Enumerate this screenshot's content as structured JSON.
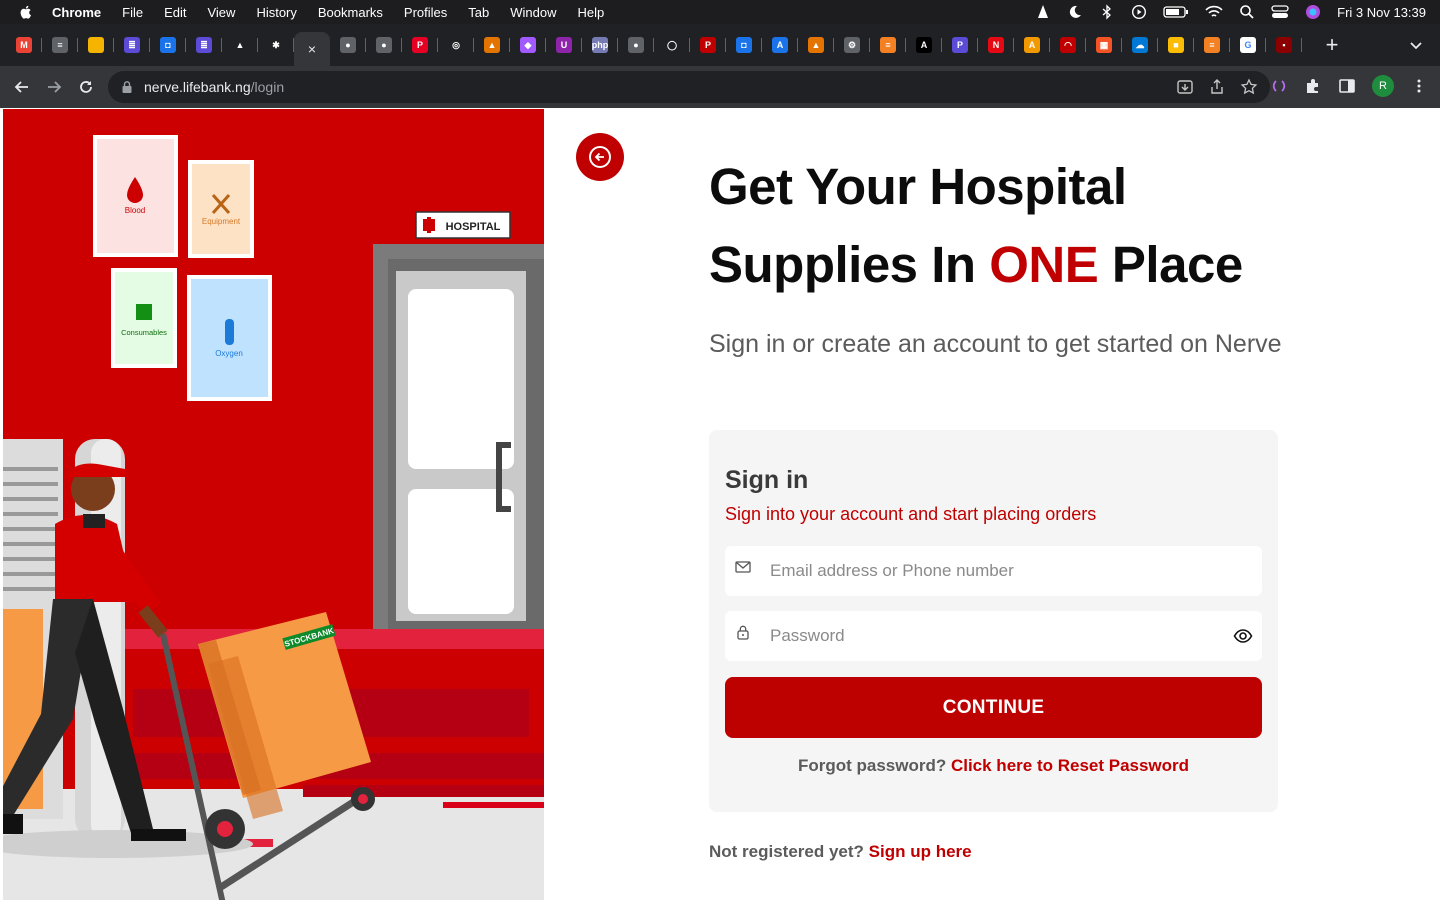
{
  "menubar": {
    "app": "Chrome",
    "items": [
      "File",
      "Edit",
      "View",
      "History",
      "Bookmarks",
      "Profiles",
      "Tab",
      "Window",
      "Help"
    ],
    "clock": "Fri 3 Nov  13:39"
  },
  "tabs": [
    {
      "icon": "gmail-icon",
      "color": "#ea4335",
      "glyph": "M"
    },
    {
      "icon": "docs-icon",
      "color": "#5f6368",
      "glyph": "≡"
    },
    {
      "icon": "slides-icon",
      "color": "#f4b400",
      "glyph": ""
    },
    {
      "icon": "list-icon",
      "color": "#5b4bd6",
      "glyph": "≣"
    },
    {
      "icon": "shield-tab-icon",
      "color": "#1a73e8",
      "glyph": "◘"
    },
    {
      "icon": "list-icon",
      "color": "#5b4bd6",
      "glyph": "≣"
    },
    {
      "icon": "mountain-icon",
      "color": "#202124",
      "glyph": "▲"
    },
    {
      "icon": "slack-icon",
      "color": "#202124",
      "glyph": "✱"
    },
    {
      "icon": "active-tab-close-icon",
      "color": "#35363a",
      "glyph": "×",
      "active": true
    },
    {
      "icon": "globe-icon",
      "color": "#5f6368",
      "glyph": "●"
    },
    {
      "icon": "globe-icon",
      "color": "#5f6368",
      "glyph": "●"
    },
    {
      "icon": "pinterest-icon",
      "color": "#e60023",
      "glyph": "P"
    },
    {
      "icon": "search-tab-icon",
      "color": "#202124",
      "glyph": "◎"
    },
    {
      "icon": "mountain-icon",
      "color": "#e37400",
      "glyph": "▲"
    },
    {
      "icon": "figma-icon",
      "color": "#a259ff",
      "glyph": "◆"
    },
    {
      "icon": "shield-purple-icon",
      "color": "#8e24aa",
      "glyph": "U"
    },
    {
      "icon": "php-icon",
      "color": "#777bb3",
      "glyph": "php"
    },
    {
      "icon": "globe-icon",
      "color": "#5f6368",
      "glyph": "●"
    },
    {
      "icon": "github-icon",
      "color": "#202124",
      "glyph": "◯"
    },
    {
      "icon": "pinterest-icon",
      "color": "#c00000",
      "glyph": "P"
    },
    {
      "icon": "shield-tab-icon",
      "color": "#1a73e8",
      "glyph": "◘"
    },
    {
      "icon": "app-a-icon",
      "color": "#1a73e8",
      "glyph": "A"
    },
    {
      "icon": "mountain-icon",
      "color": "#e37400",
      "glyph": "▲"
    },
    {
      "icon": "gear-tab-icon",
      "color": "#5f6368",
      "glyph": "⚙"
    },
    {
      "icon": "stack-icon",
      "color": "#f48024",
      "glyph": "≡"
    },
    {
      "icon": "ai-icon",
      "color": "#000000",
      "glyph": "A"
    },
    {
      "icon": "p-icon",
      "color": "#5b4bd6",
      "glyph": "P"
    },
    {
      "icon": "netflix-icon",
      "color": "#e50914",
      "glyph": "N"
    },
    {
      "icon": "a-circle-icon",
      "color": "#f29900",
      "glyph": "A"
    },
    {
      "icon": "gauge-icon",
      "color": "#c00000",
      "glyph": "◠"
    },
    {
      "icon": "microsoft-icon",
      "color": "#f35325",
      "glyph": "▦"
    },
    {
      "icon": "cloud-icon",
      "color": "#0078d4",
      "glyph": "☁"
    },
    {
      "icon": "keep-icon",
      "color": "#fbbc04",
      "glyph": "■"
    },
    {
      "icon": "stack-icon",
      "color": "#f48024",
      "glyph": "≡"
    },
    {
      "icon": "google-icon",
      "color": "#ffffff",
      "glyph": "G"
    },
    {
      "icon": "red-app-icon",
      "color": "#8b0000",
      "glyph": "▪"
    }
  ],
  "omnibox": {
    "host": "nerve.lifebank.ng",
    "path": "/login"
  },
  "profile_initial": "R",
  "illustration": {
    "posters": [
      "Blood",
      "Equipment",
      "Consumables",
      "Oxygen"
    ],
    "sign": "HOSPITAL",
    "box_label": "STOCKBANK"
  },
  "page": {
    "headline_line1": "Get Your Hospital",
    "headline_line2_pre": "Supplies In ",
    "headline_accent": "ONE",
    "headline_line2_post": " Place",
    "subhead": "Sign in or create an account to get started on Nerve"
  },
  "signin": {
    "title": "Sign in",
    "subtitle": "Sign into your account and start placing orders",
    "email_placeholder": "Email address or Phone number",
    "password_placeholder": "Password",
    "continue_label": "CONTINUE",
    "forgot_prefix": "Forgot password? ",
    "forgot_link": "Click here to Reset Password"
  },
  "signup": {
    "prefix": "Not registered yet? ",
    "link": "Sign up here"
  },
  "colors": {
    "brand_red": "#c00000",
    "menubar": "#1d1d1f",
    "tabstrip": "#202124",
    "toolbar": "#35363a"
  }
}
